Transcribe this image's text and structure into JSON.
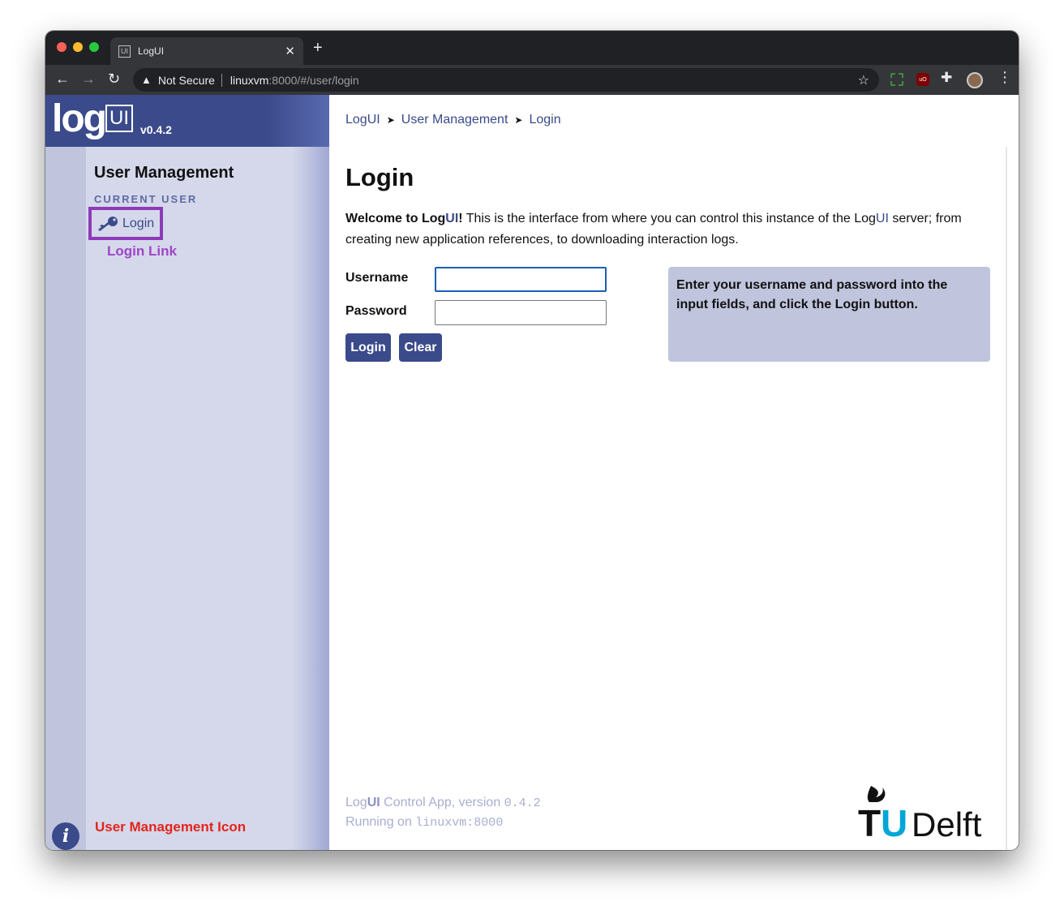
{
  "browser": {
    "tab_title": "LogUI",
    "favicon_text": "UI",
    "tab_close": "✕",
    "new_tab": "+",
    "security_label": "Not Secure",
    "url_host": "linuxvm",
    "url_rest": ":8000/#/user/login"
  },
  "app": {
    "logo_text": "log",
    "logo_box_text": "UI",
    "version": "v0.4.2"
  },
  "sidebar": {
    "title": "User Management",
    "section_label": "CURRENT USER",
    "login_item": "Login",
    "login_annotation": "Login Link",
    "info_glyph": "i",
    "user_icon_annotation": "User Management Icon"
  },
  "breadcrumb": {
    "items": [
      "LogUI",
      "User Management",
      "Login"
    ],
    "separator": "➤"
  },
  "page": {
    "title": "Login",
    "intro_bold_1": "Welcome to Log",
    "intro_accent_1": "UI",
    "intro_bold_2": "!",
    "intro_text_1": " This is the interface from where you can control this instance of the Log",
    "intro_accent_2": "UI",
    "intro_text_2": " server; from creating new application references, to downloading interaction logs."
  },
  "form": {
    "username_label": "Username",
    "password_label": "Password",
    "username_value": "",
    "password_value": "",
    "login_button": "Login",
    "clear_button": "Clear",
    "help_text": "Enter your username and password into the input fields, and click the Login button."
  },
  "footer": {
    "line1_prefix": "Log",
    "line1_bold": "UI",
    "line1_text": " Control App, version ",
    "line1_version": "0.4.2",
    "line2_text": "Running on ",
    "line2_host": "linuxvm:8000"
  },
  "branding": {
    "tudelft_t": "T",
    "tudelft_u": "U",
    "tudelft_rest": "Delft"
  },
  "colors": {
    "accent": "#3a4a8a",
    "sidebar_bg": "#d4d8ea",
    "help_bg": "#c0c5dd",
    "annotation_purple": "#a044c8",
    "annotation_red": "#e4241c",
    "tudelft_blue": "#00a6d6"
  }
}
